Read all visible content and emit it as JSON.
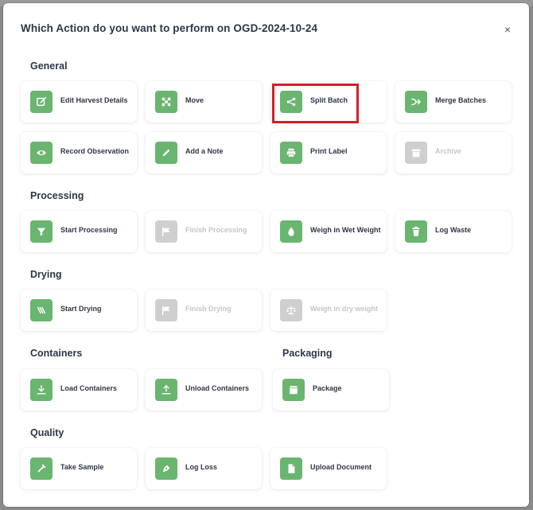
{
  "modal": {
    "title": "Which Action do you want to perform on OGD-2024-10-24",
    "close": "×"
  },
  "sections": {
    "general": "General",
    "processing": "Processing",
    "drying": "Drying",
    "containers": "Containers",
    "packaging": "Packaging",
    "quality": "Quality"
  },
  "actions": {
    "edit_harvest_details": "Edit Harvest Details",
    "move": "Move",
    "split_batch": "Split Batch",
    "merge_batches": "Merge Batches",
    "record_observation": "Record Observation",
    "add_note": "Add a Note",
    "print_label": "Print Label",
    "archive": "Archive",
    "start_processing": "Start Processing",
    "finish_processing": "Finish Processing",
    "weigh_wet": "Weigh in Wet Weight",
    "log_waste": "Log Waste",
    "start_drying": "Start Drying",
    "finish_drying": "Finish Drying",
    "weigh_dry": "Weigh in dry weight",
    "load_containers": "Load Containers",
    "unload_containers": "Unload Containers",
    "package": "Package",
    "take_sample": "Take Sample",
    "log_loss": "Log Loss",
    "upload_document": "Upload Document"
  },
  "colors": {
    "accent_green": "#6ab56f",
    "disabled_gray": "#cfcfcf",
    "highlight_red": "#d0202a"
  }
}
